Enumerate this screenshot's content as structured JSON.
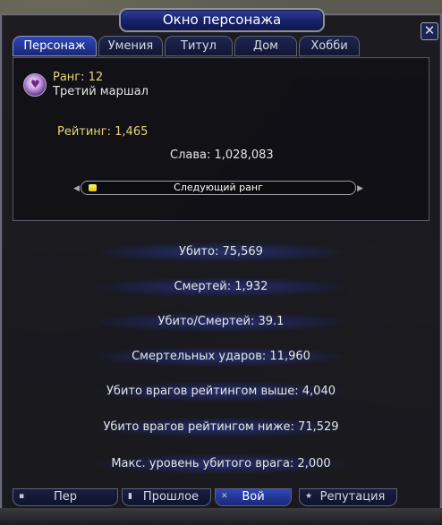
{
  "window": {
    "title": "Окно персонажа"
  },
  "tabs": [
    {
      "label": "Персонаж"
    },
    {
      "label": "Умения"
    },
    {
      "label": "Титул"
    },
    {
      "label": "Дом"
    },
    {
      "label": "Хобби"
    }
  ],
  "rank": {
    "rank_label": "Ранг: 12",
    "rank_name": "Третий маршал",
    "rating": "Рейтинг: 1,465",
    "glory": "Слава: 1,028,083",
    "next_rank_label": "Следующий ранг",
    "next_rank_progress": 0.03
  },
  "stats": [
    {
      "label": "Убито: 75,569"
    },
    {
      "label": "Смертей: 1,932"
    },
    {
      "label": "Убито/Смертей: 39.1"
    },
    {
      "label": "Смертельных ударов: 11,960"
    },
    {
      "label": "Убито врагов рейтингом выше: 4,040"
    },
    {
      "label": "Убито врагов рейтингом ниже: 71,529"
    },
    {
      "label": "Макс. уровень убитого врага: 2,000"
    }
  ],
  "bottom_tabs": [
    {
      "label": "Пер",
      "icon": "page-icon"
    },
    {
      "label": "Прошлое",
      "icon": "scroll-icon"
    },
    {
      "label": "Вой",
      "icon": "swords-icon"
    },
    {
      "label": "Репутация",
      "icon": "star-icon"
    }
  ],
  "colors": {
    "accent": "#2f47b8",
    "title_plate": "#17216a",
    "progress": "#e3c51a",
    "rank_text": "#e8d67a"
  }
}
